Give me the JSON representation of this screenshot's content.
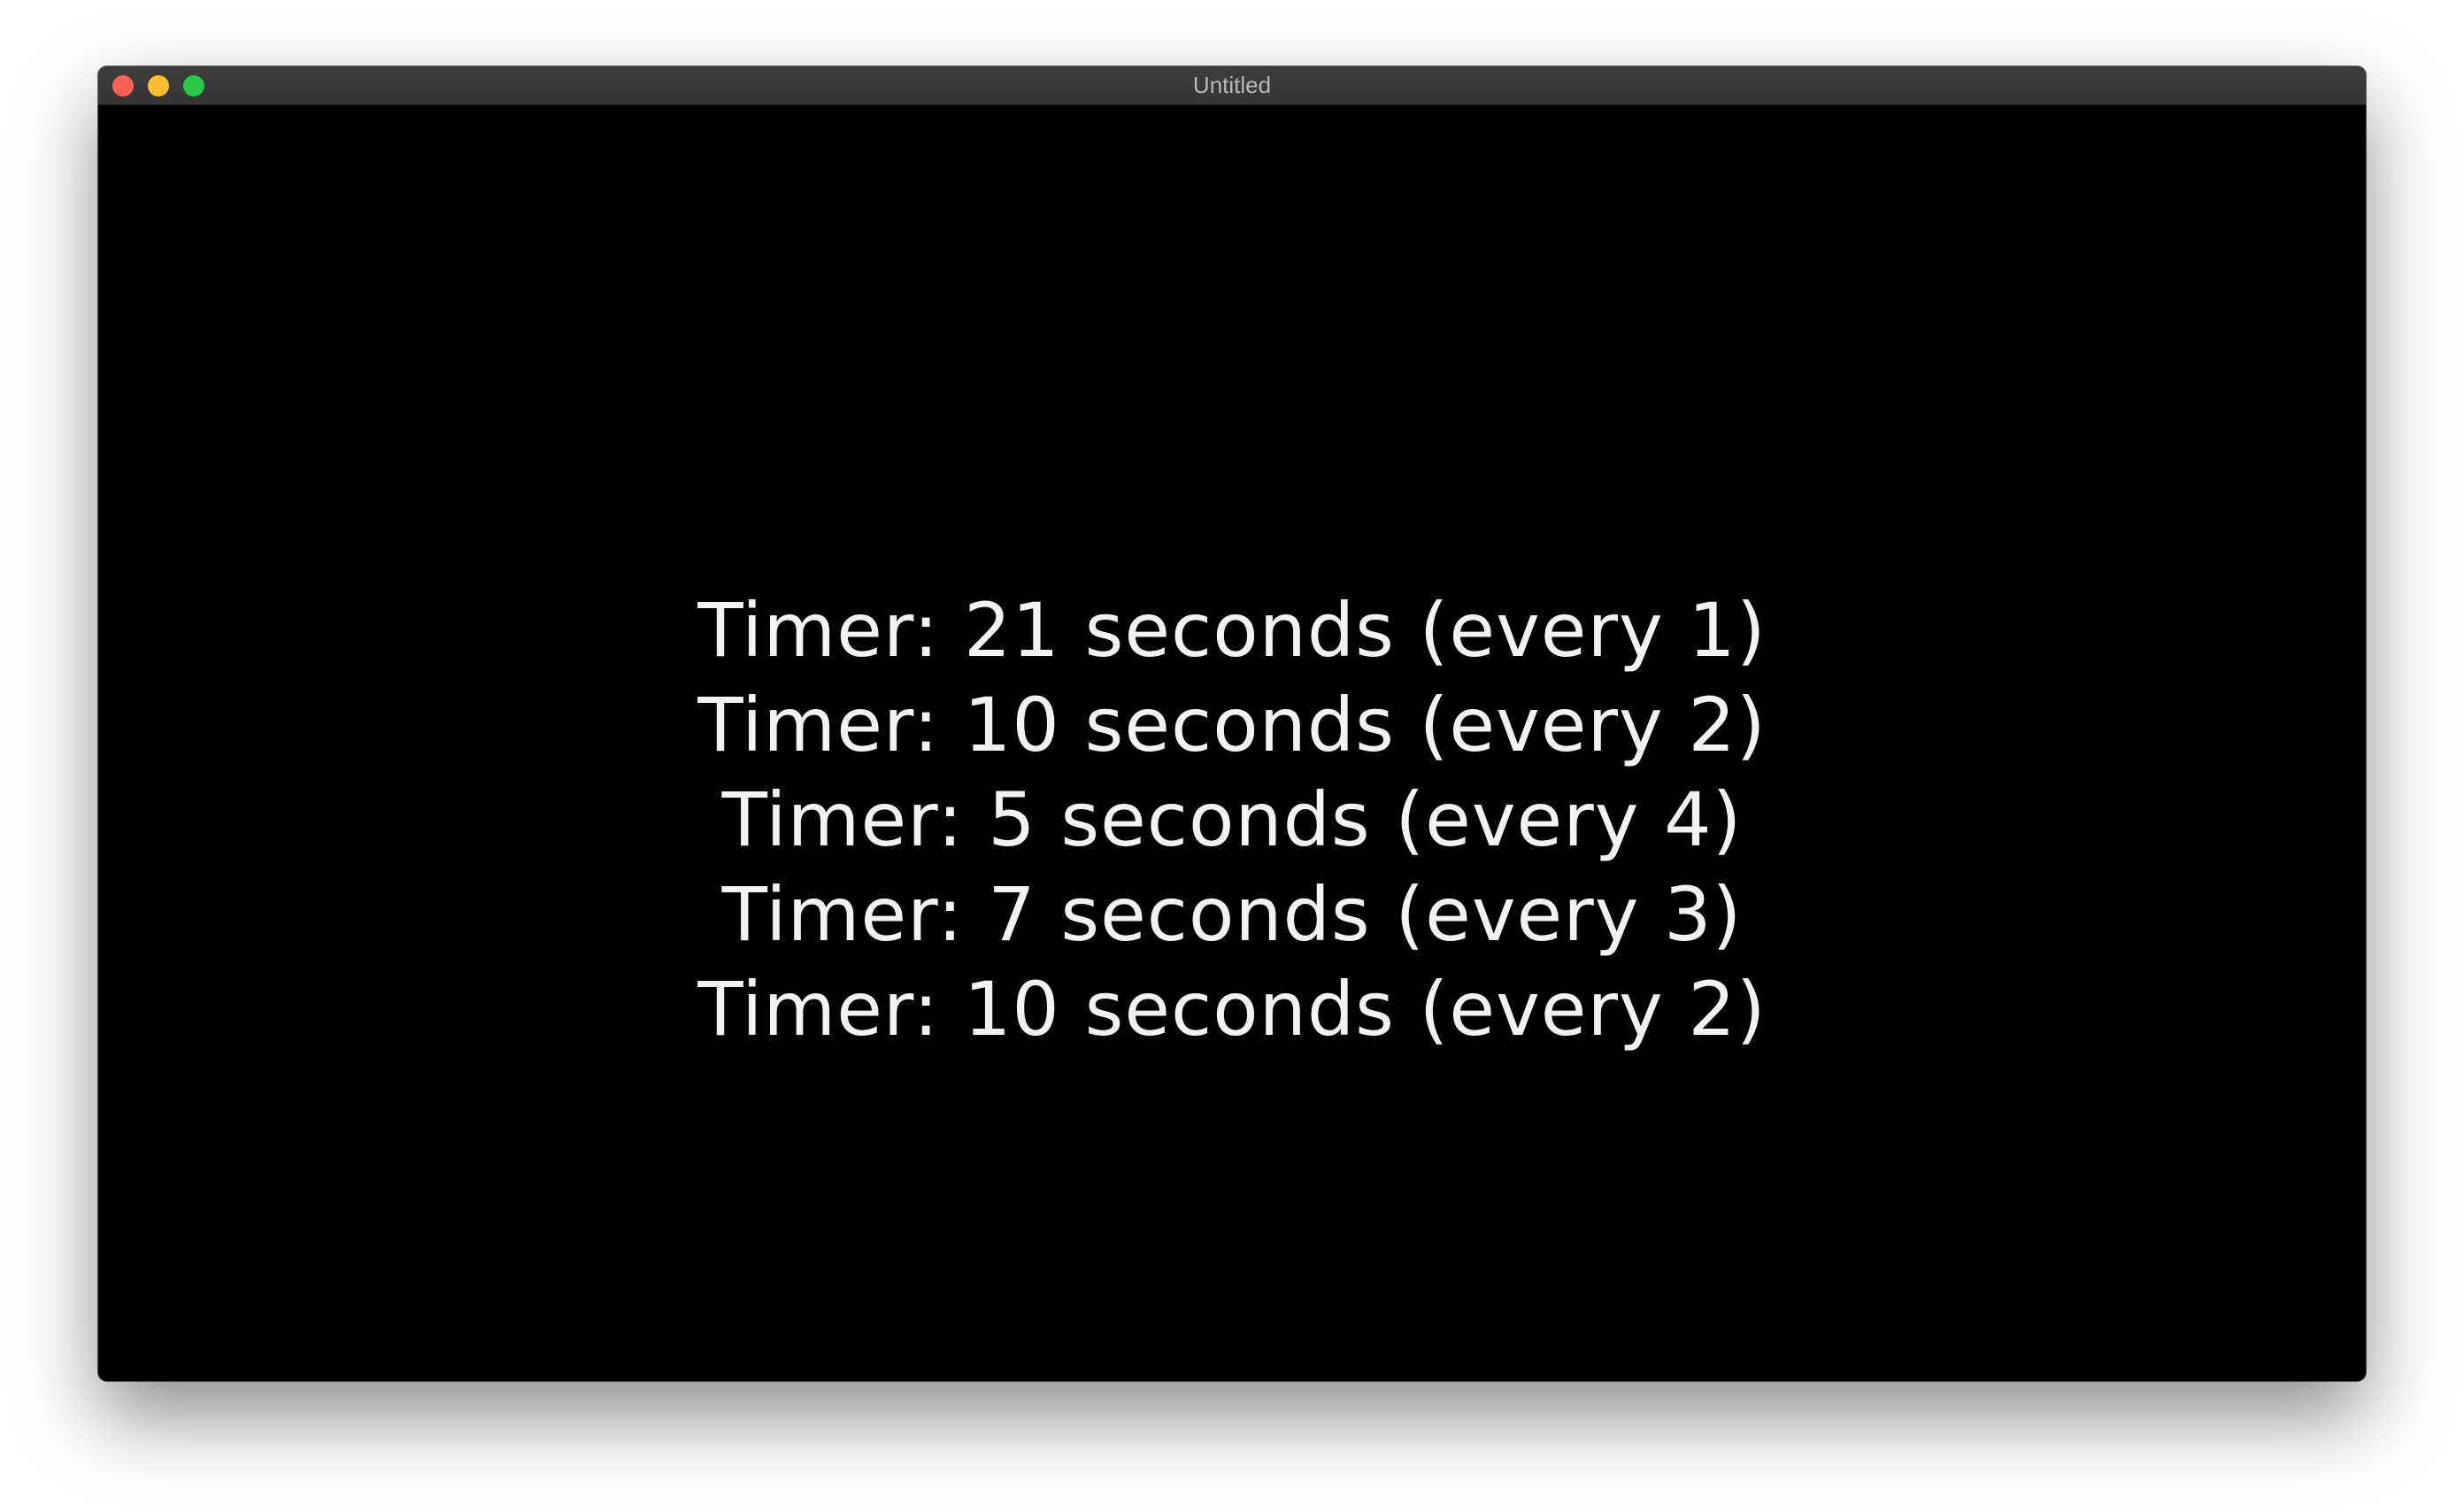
{
  "window": {
    "title": "Untitled"
  },
  "timers": [
    {
      "text": "Timer: 21 seconds (every 1)"
    },
    {
      "text": "Timer: 10 seconds (every 2)"
    },
    {
      "text": "Timer: 5 seconds (every 4)"
    },
    {
      "text": "Timer: 7 seconds (every 3)"
    },
    {
      "text": "Timer: 10 seconds (every 2)"
    }
  ],
  "colors": {
    "background": "#000000",
    "text": "#f2f2f2",
    "close": "#fe5f57",
    "minimize": "#febc2e",
    "maximize": "#28c840"
  }
}
